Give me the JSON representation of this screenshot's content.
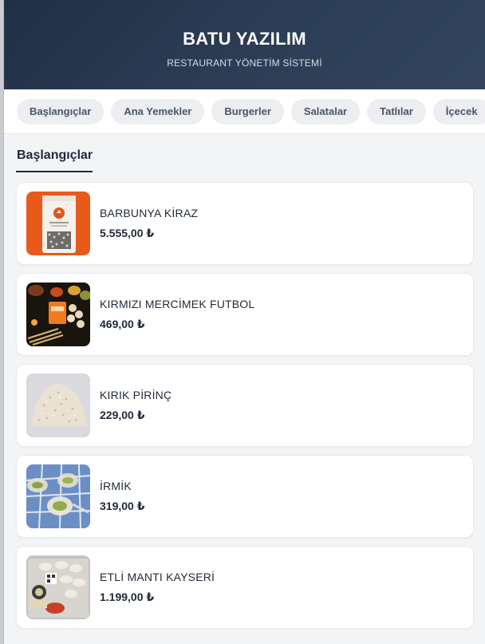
{
  "header": {
    "title": "BATU YAZILIM",
    "subtitle": "RESTAURANT YÖNETİM SİSTEMİ"
  },
  "tabs": [
    {
      "label": "Başlangıçlar"
    },
    {
      "label": "Ana Yemekler"
    },
    {
      "label": "Burgerler"
    },
    {
      "label": "Salatalar"
    },
    {
      "label": "Tatlılar"
    },
    {
      "label": "İçecek"
    }
  ],
  "section": {
    "title": "Başlangıçlar",
    "items": [
      {
        "name": "BARBUNYA KİRAZ",
        "price": "5.555,00 ₺",
        "image": "bean-package-photo"
      },
      {
        "name": "KIRMIZI MERCİMEK FUTBOL",
        "price": "469,00 ₺",
        "image": "lentil-package-photo"
      },
      {
        "name": "KIRIK PİRİNÇ",
        "price": "229,00 ₺",
        "image": "broken-rice-photo"
      },
      {
        "name": "İRMİK",
        "price": "319,00 ₺",
        "image": "semolina-dessert-photo"
      },
      {
        "name": "ETLİ MANTI KAYSERİ",
        "price": "1.199,00 ₺",
        "image": "manti-package-photo"
      }
    ]
  },
  "colors": {
    "header_gradient_start": "#223046",
    "header_gradient_end": "#34455f",
    "accent": "#1e293b",
    "tab_bg": "#eceef1",
    "page_bg": "#f3f4f6"
  }
}
